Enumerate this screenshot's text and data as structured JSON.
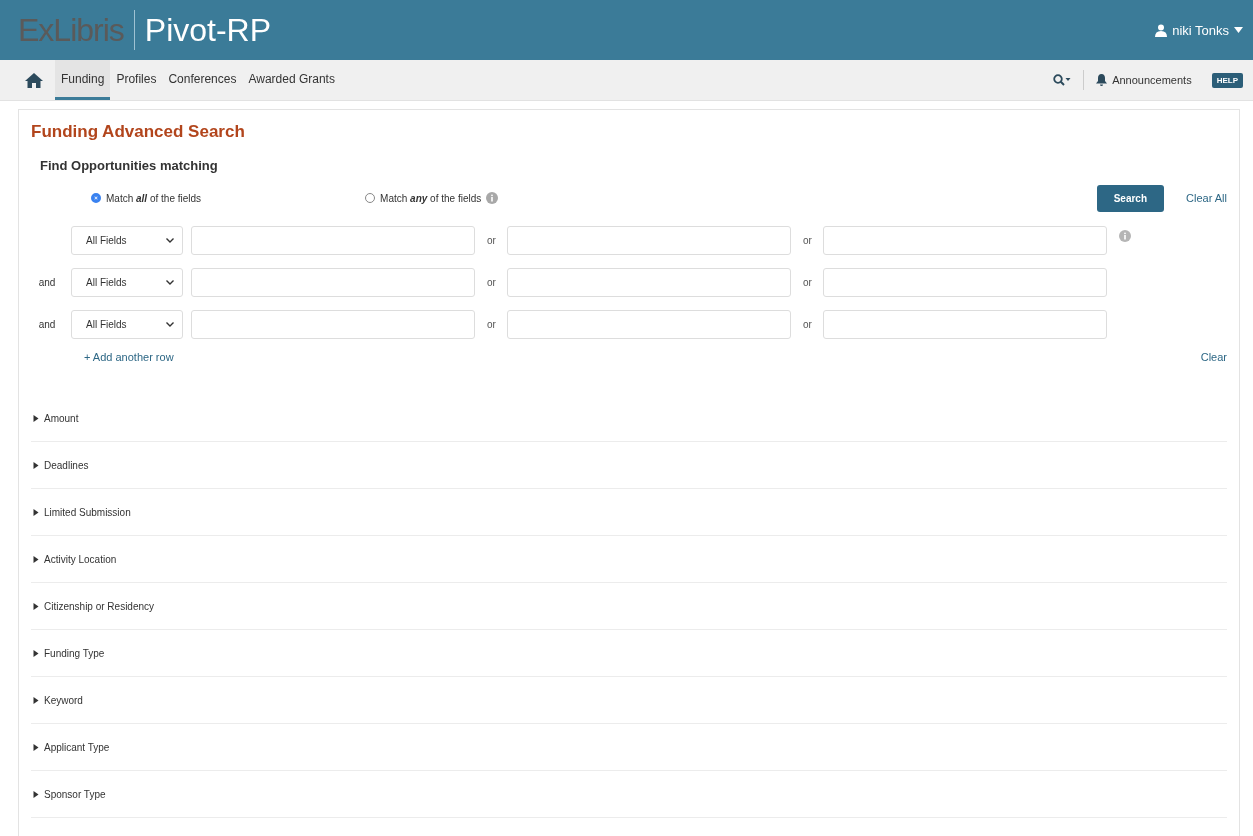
{
  "header": {
    "logo_brand": "ExLibris",
    "logo_product": "Pivot-RP",
    "user": "niki Tonks"
  },
  "nav": {
    "tabs": [
      {
        "label": "Funding",
        "selected": true
      },
      {
        "label": "Profiles",
        "selected": false
      },
      {
        "label": "Conferences",
        "selected": false
      },
      {
        "label": "Awarded Grants",
        "selected": false
      }
    ],
    "announcements": "Announcements",
    "help": "HELP"
  },
  "page": {
    "title": "Funding Advanced Search",
    "subtitle": "Find Opportunities matching",
    "match_options": [
      {
        "label": "Match **all** of the fields",
        "selected": true,
        "info": false
      },
      {
        "label": "Match **any** of the fields",
        "selected": false,
        "info": true
      }
    ],
    "search_button": "Search",
    "clear_all": "Clear All",
    "rows": [
      {
        "connector": "",
        "field": "All Fields",
        "or_labels": [
          "or",
          "or"
        ],
        "info": true
      },
      {
        "connector": "and",
        "field": "All Fields",
        "or_labels": [
          "or",
          "or"
        ],
        "info": false
      },
      {
        "connector": "and",
        "field": "All Fields",
        "or_labels": [
          "or",
          "or"
        ],
        "info": false
      }
    ],
    "add_row": "+ Add another row",
    "clear": "Clear",
    "sections": [
      {
        "label": "Amount",
        "expanded": false
      },
      {
        "label": "Deadlines",
        "expanded": false
      },
      {
        "label": "Limited Submission",
        "expanded": false
      },
      {
        "label": "Activity Location",
        "expanded": false
      },
      {
        "label": "Citizenship or Residency",
        "expanded": false
      },
      {
        "label": "Funding Type",
        "expanded": false
      },
      {
        "label": "Keyword",
        "expanded": false
      },
      {
        "label": "Applicant Type",
        "expanded": false
      },
      {
        "label": "Sponsor Type",
        "expanded": false
      }
    ]
  }
}
